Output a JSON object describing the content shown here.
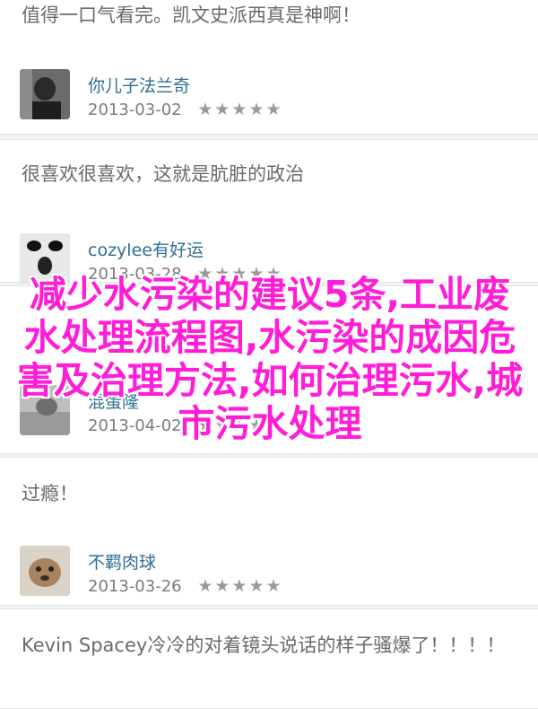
{
  "comments": [
    {
      "text": "值得一口气看完。凯文史派西真是神啊！",
      "username": "你儿子法兰奇",
      "date": "2013-03-02",
      "stars": "★★★★★"
    },
    {
      "text": "很喜欢很喜欢，这就是肮脏的政治",
      "username": "cozylee有好运",
      "date": "2013-03-28",
      "stars": "★★★★★"
    },
    {
      "text": "",
      "username": "混蛋隆",
      "date": "2013-04-02",
      "stars": "★★★★★"
    },
    {
      "text": "过瘾！",
      "username": "不羁肉球",
      "date": "2013-03-26",
      "stars": "★★★★★"
    },
    {
      "text": "Kevin Spacey冷冷的对着镜头说话的样子骚爆了！！！！",
      "username": "",
      "date": "",
      "stars": ""
    }
  ],
  "overlay": {
    "text": "减少水污染的建议5条,工业废水处理流程图,水污染的成因危害及治理方法,如何治理污水,城市污水处理"
  },
  "colors": {
    "username": "#2f6f93",
    "overlay_text": "#ff1dd8",
    "card_background": "#ffffff",
    "page_background": "#f2f2f2"
  }
}
